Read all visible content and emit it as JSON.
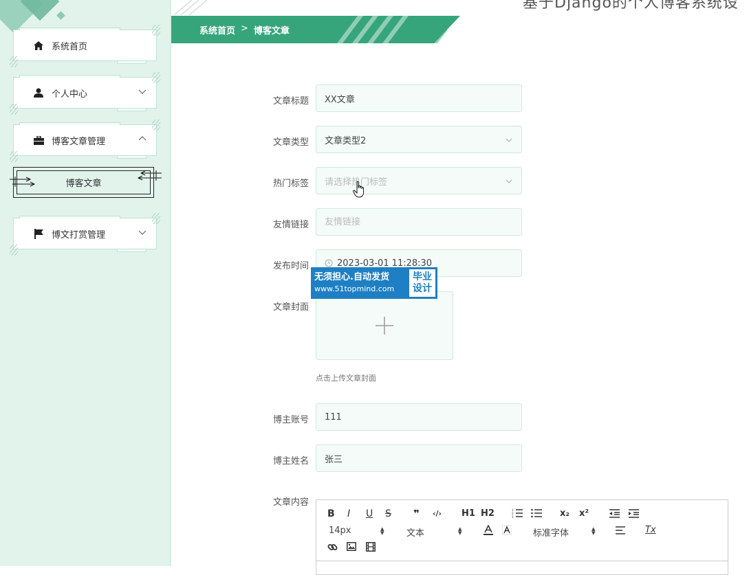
{
  "sidebar": {
    "items": [
      {
        "label": "系统首页",
        "icon": "home-icon"
      },
      {
        "label": "个人中心",
        "icon": "user-icon"
      },
      {
        "label": "博客文章管理",
        "icon": "briefcase-icon"
      },
      {
        "label": "博文打赏管理",
        "icon": "flag-icon"
      }
    ],
    "subitem": {
      "label": "博客文章"
    }
  },
  "header": {
    "title_partial": "基于Django的个人博客系统设",
    "breadcrumb": {
      "home": "系统首页",
      "separator": ">",
      "current": "博客文章"
    }
  },
  "form": {
    "title": {
      "label": "文章标题",
      "value": "XX文章"
    },
    "type": {
      "label": "文章类型",
      "value": "文章类型2"
    },
    "tags": {
      "label": "热门标签",
      "placeholder": "请选择热门标签"
    },
    "link": {
      "label": "友情链接",
      "placeholder": "友情链接"
    },
    "time": {
      "label": "发布时间",
      "value": "2023-03-01 11:28:30"
    },
    "cover": {
      "label": "文章封面",
      "hint": "点击上传文章封面"
    },
    "account": {
      "label": "博主账号",
      "value": "111"
    },
    "name": {
      "label": "博主姓名",
      "value": "张三"
    },
    "content": {
      "label": "文章内容"
    }
  },
  "watermark": {
    "line1": "无须担心.自动发货",
    "line2": "www.51topmind.com",
    "badge1": "毕业",
    "badge2": "设计"
  },
  "editor": {
    "bold": "B",
    "italic": "I",
    "underline": "U",
    "strike": "S",
    "quote": "❞",
    "code": "‹/›",
    "h1": "H1",
    "h2": "H2",
    "sub": "x₂",
    "sup": "x²",
    "font_size": "14px",
    "paragraph": "文本",
    "font_family": "标准字体",
    "clean": "Tx"
  },
  "colors": {
    "primary": "#36a57b",
    "sidebar_bg": "#e2f3ec",
    "field_bg": "#f4fbf8",
    "watermark": "#1e7fc4"
  }
}
